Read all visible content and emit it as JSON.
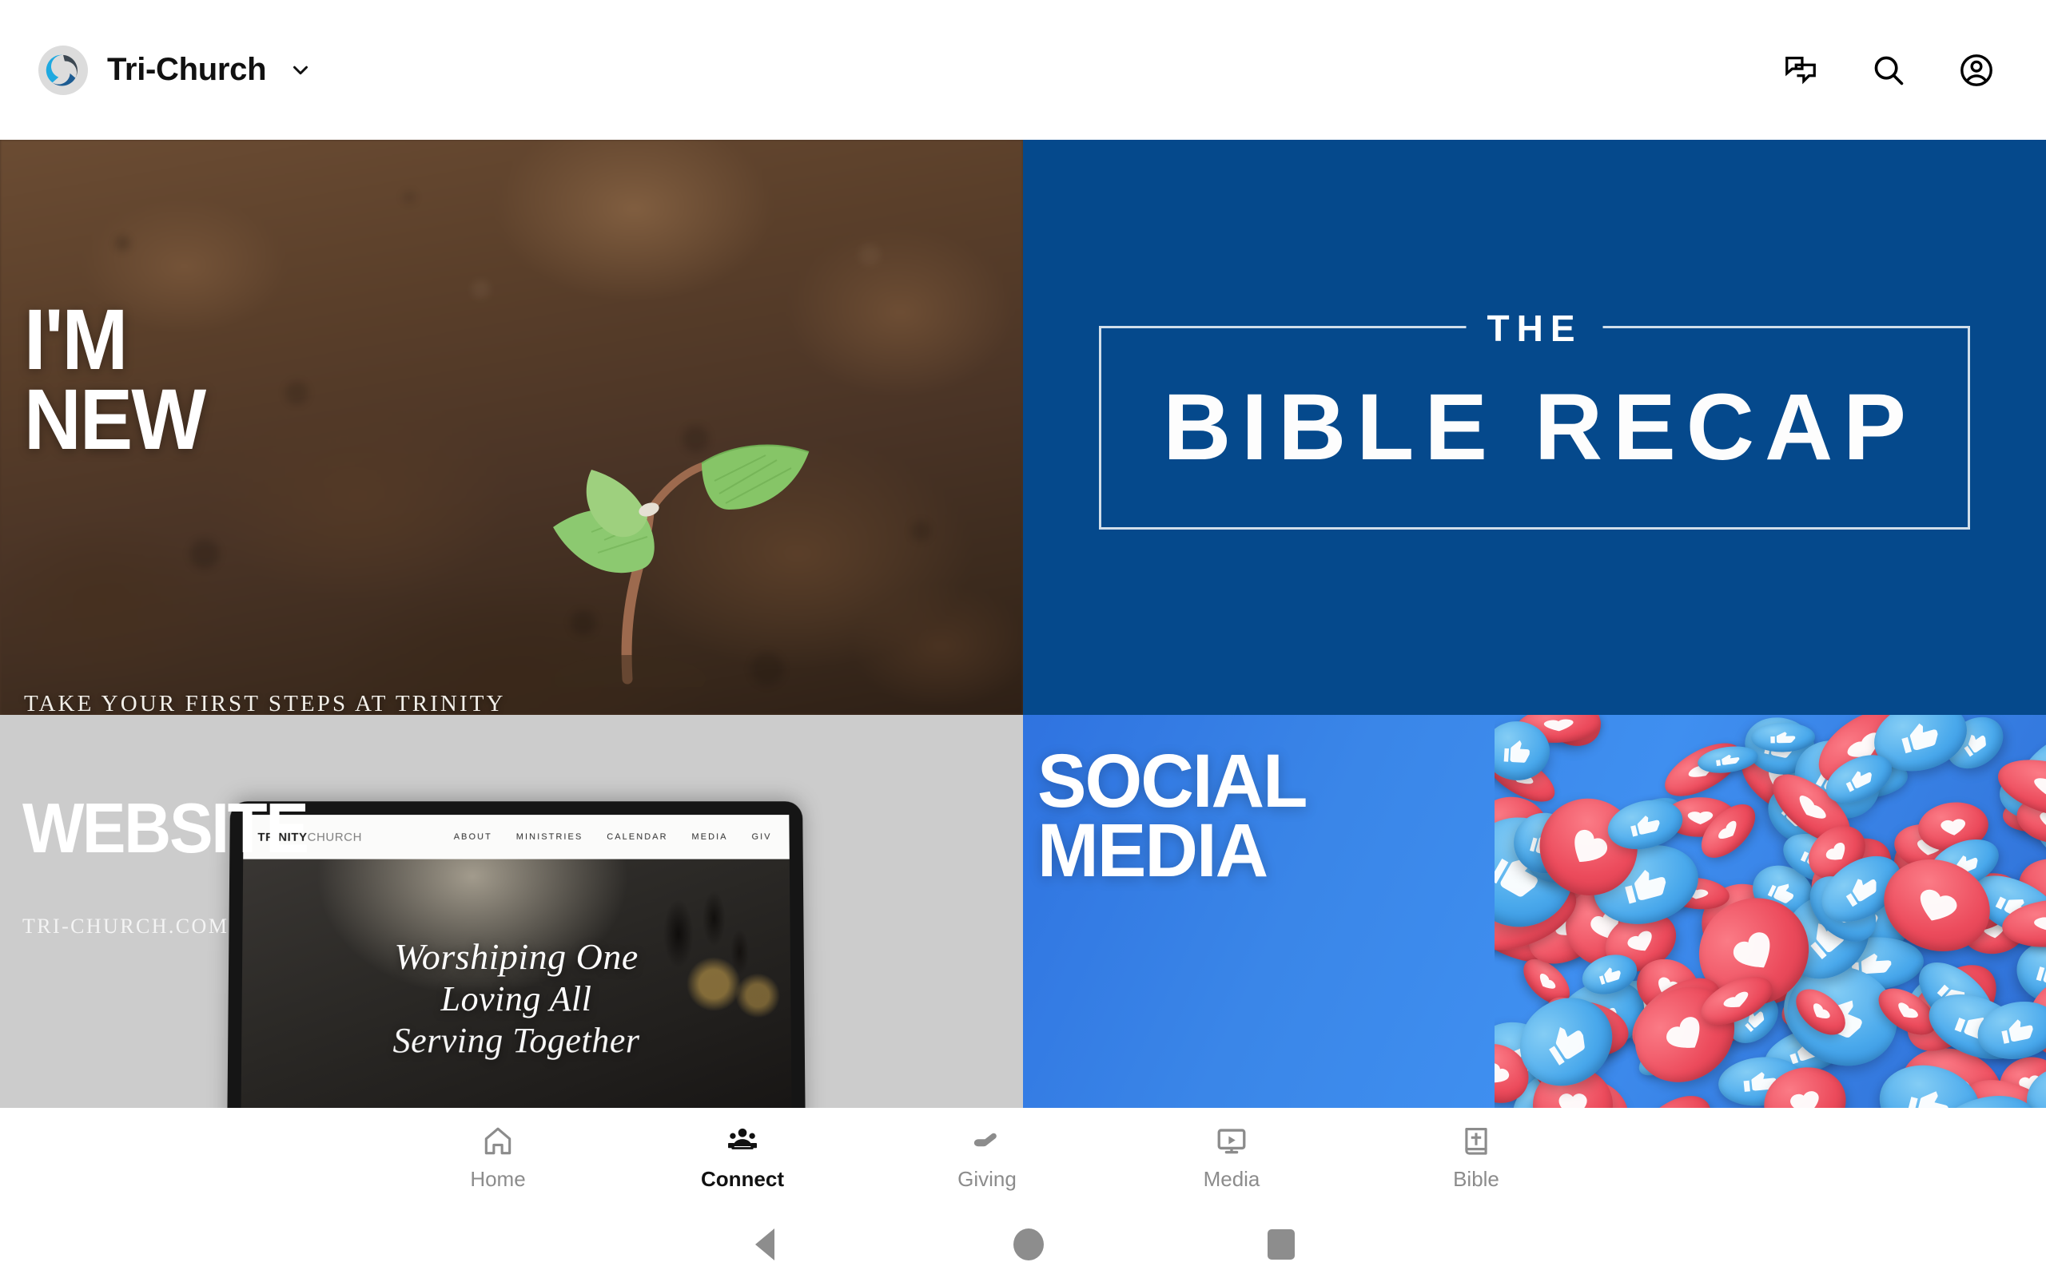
{
  "app": {
    "name": "Tri-Church"
  },
  "header": {
    "brand_name": "Tri-Church",
    "logo_icon": "tri-church-swirl-logo",
    "dropdown_icon": "chevron-down-icon",
    "actions": [
      {
        "icon": "chat-bubbles-icon",
        "label": "Messages"
      },
      {
        "icon": "search-icon",
        "label": "Search"
      },
      {
        "icon": "account-circle-icon",
        "label": "Account"
      }
    ]
  },
  "tiles": [
    {
      "id": "im-new",
      "title": "I'M",
      "title2": "NEW",
      "subtitle": "TAKE YOUR FIRST STEPS AT TRINITY",
      "image": "seedling-sprouting-in-soil"
    },
    {
      "id": "bible-recap",
      "eyebrow": "THE",
      "title": "BIBLE RECAP",
      "background_color": "#05498c"
    },
    {
      "id": "website",
      "title": "WEBSITE",
      "subtitle": "TRI-CHURCH.COM",
      "background_color": "#cccccc",
      "laptop_preview": {
        "site_logo_bold": "TRINITY",
        "site_logo_light": "CHURCH",
        "nav": [
          "ABOUT",
          "MINISTRIES",
          "CALENDAR",
          "MEDIA",
          "GIV"
        ],
        "hero_line1": "Worshiping One",
        "hero_line2": "Loving All",
        "hero_line3": "Serving Together"
      }
    },
    {
      "id": "social-media",
      "title": "SOCIAL",
      "title2": "MEDIA",
      "image": "3d-like-and-heart-reaction-tokens"
    }
  ],
  "bottom_nav": {
    "items": [
      {
        "label": "Home",
        "icon": "home-icon",
        "active": false
      },
      {
        "label": "Connect",
        "icon": "groups-icon",
        "active": true
      },
      {
        "label": "Giving",
        "icon": "giving-hand-icon",
        "active": false
      },
      {
        "label": "Media",
        "icon": "media-play-icon",
        "active": false
      },
      {
        "label": "Bible",
        "icon": "bible-book-icon",
        "active": false
      }
    ],
    "active_color": "#111111",
    "inactive_color": "#8c8c8c"
  },
  "system_bar": {
    "buttons": [
      {
        "icon": "android-back-icon",
        "label": "Back"
      },
      {
        "icon": "android-home-icon",
        "label": "Home"
      },
      {
        "icon": "android-recents-icon",
        "label": "Recent apps"
      }
    ]
  }
}
